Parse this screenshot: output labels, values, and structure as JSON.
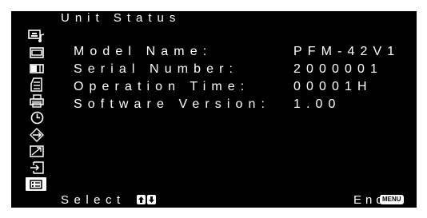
{
  "screen": {
    "title": "Unit Status",
    "fields": [
      {
        "label": "Model Name:",
        "value": "PFM-42V1"
      },
      {
        "label": "Serial Number:",
        "value": "2000001"
      },
      {
        "label": "Operation Time:",
        "value": "00001H"
      },
      {
        "label": "Software Version:",
        "value": "1.00"
      }
    ],
    "sidebar_icons": [
      {
        "name": "picture-sound-icon",
        "active": false
      },
      {
        "name": "screen-icon",
        "active": false
      },
      {
        "name": "dual-screen-icon",
        "active": false
      },
      {
        "name": "settings-list-icon",
        "active": false
      },
      {
        "name": "printer-icon",
        "active": false
      },
      {
        "name": "clock-icon",
        "active": false
      },
      {
        "name": "connection-arrows-icon",
        "active": false
      },
      {
        "name": "trend-arrow-icon",
        "active": false
      },
      {
        "name": "input-icon",
        "active": false
      },
      {
        "name": "unit-status-icon",
        "active": true
      }
    ],
    "footer": {
      "select_label": "Select",
      "select_keys": [
        "up-arrow-key-icon",
        "down-arrow-key-icon"
      ],
      "end_label": "End",
      "end_key": "MENU"
    },
    "colors": {
      "background": "#000000",
      "text": "#ffffff",
      "page": "#ffffff"
    }
  }
}
